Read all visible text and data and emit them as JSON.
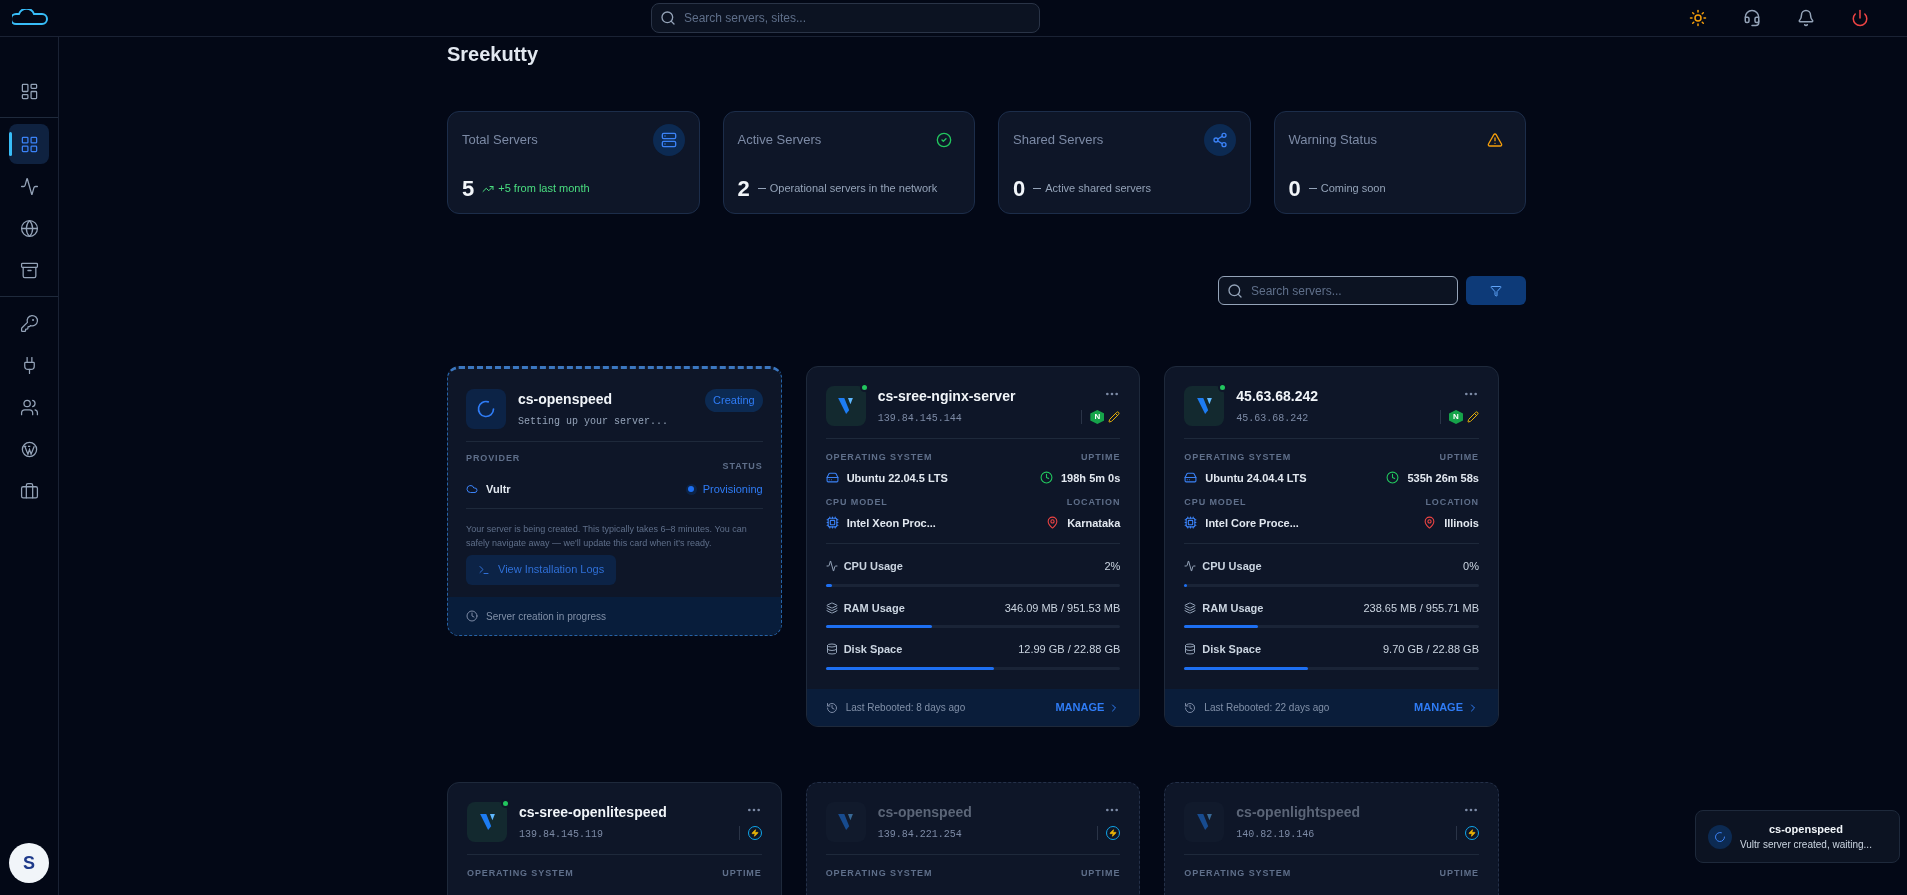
{
  "topbar": {
    "search": {
      "placeholder": "Search servers, sites..."
    }
  },
  "sidebar": {
    "groups": [
      [
        {
          "selected": false
        }
      ],
      [
        {
          "selected": true
        },
        {
          "selected": false
        },
        {
          "selected": false
        },
        {
          "selected": false
        }
      ],
      [
        {
          "selected": false
        },
        {
          "selected": false
        },
        {
          "selected": false
        },
        {
          "selected": false
        },
        {
          "selected": false
        }
      ]
    ],
    "avatar": "S"
  },
  "page": {
    "title": "Sreekutty"
  },
  "stats": [
    {
      "label": "Total Servers",
      "value": "5",
      "note": "+5 from last month",
      "kind": "trend"
    },
    {
      "label": "Active Servers",
      "value": "2",
      "note": "Operational servers in the network",
      "kind": "plain"
    },
    {
      "label": "Shared Servers",
      "value": "0",
      "note": "Active shared servers",
      "kind": "plain"
    },
    {
      "label": "Warning Status",
      "value": "0",
      "note": "Coming soon",
      "kind": "plain"
    }
  ],
  "server_search": {
    "placeholder": "Search servers..."
  },
  "servers": [
    {
      "kind": "creating",
      "name": "cs-openspeed",
      "subtitle": "Setting up your server...",
      "badge": "Creating",
      "provider_label": "PROVIDER",
      "provider": "Vultr",
      "status_label": "STATUS",
      "status": "Provisioning",
      "message": "Your server is being created. This typically takes 6–8 minutes. You can safely navigate away — we'll update this card when it's ready.",
      "logs_button": "View Installation Logs",
      "footer": "Server creation in progress"
    },
    {
      "kind": "active",
      "online": true,
      "name": "cs-sree-nginx-server",
      "ip": "139.84.145.144",
      "stack": [
        {
          "kind": "nginx",
          "label": "N"
        },
        {
          "kind": "pencil"
        }
      ],
      "os_label": "OPERATING SYSTEM",
      "os": "Ubuntu 22.04.5 LTS",
      "uptime_label": "UPTIME",
      "uptime": "198h 5m 0s",
      "cpu_label": "CPU MODEL",
      "cpu": "Intel Xeon Proc...",
      "location_label": "LOCATION",
      "location": "Karnataka",
      "metrics": [
        {
          "kind": "cpu",
          "label": "CPU Usage",
          "reading": "2%",
          "level": 0.02
        },
        {
          "kind": "ram",
          "label": "RAM Usage",
          "reading": "346.09 MB / 951.53 MB",
          "level": 0.36
        },
        {
          "kind": "disk",
          "label": "Disk Space",
          "reading": "12.99 GB / 22.88 GB",
          "level": 0.57
        }
      ],
      "footer": "Last Rebooted: 8 days ago",
      "manage": "MANAGE"
    },
    {
      "kind": "active",
      "online": true,
      "name": "45.63.68.242",
      "ip": "45.63.68.242",
      "stack": [
        {
          "kind": "nginx",
          "label": "N"
        },
        {
          "kind": "pencil"
        }
      ],
      "os_label": "OPERATING SYSTEM",
      "os": "Ubuntu 24.04.4 LTS",
      "uptime_label": "UPTIME",
      "uptime": "535h 26m 58s",
      "cpu_label": "CPU MODEL",
      "cpu": "Intel Core Proce...",
      "location_label": "LOCATION",
      "location": "Illinois",
      "metrics": [
        {
          "kind": "cpu",
          "label": "CPU Usage",
          "reading": "0%",
          "level": 0.0
        },
        {
          "kind": "ram",
          "label": "RAM Usage",
          "reading": "238.65 MB / 955.71 MB",
          "level": 0.25
        },
        {
          "kind": "disk",
          "label": "Disk Space",
          "reading": "9.70 GB / 22.88 GB",
          "level": 0.42
        }
      ],
      "footer": "Last Rebooted: 22 days ago",
      "manage": "MANAGE"
    },
    {
      "kind": "partial",
      "online": true,
      "disabled": false,
      "name": "cs-sree-openlitespeed",
      "ip": "139.84.145.119",
      "stack": [
        {
          "kind": "lightning"
        }
      ],
      "os_label": "OPERATING SYSTEM",
      "uptime_label": "UPTIME"
    },
    {
      "kind": "partial",
      "online": false,
      "disabled": true,
      "name": "cs-openspeed",
      "ip": "139.84.221.254",
      "stack": [
        {
          "kind": "lightning"
        }
      ],
      "os_label": "OPERATING SYSTEM",
      "uptime_label": "UPTIME"
    },
    {
      "kind": "partial",
      "online": false,
      "disabled": true,
      "name": "cs-openlightspeed",
      "ip": "140.82.19.146",
      "stack": [
        {
          "kind": "lightning"
        }
      ],
      "os_label": "OPERATING SYSTEM",
      "uptime_label": "UPTIME"
    }
  ],
  "toast": {
    "title": "cs-openspeed",
    "message": "Vultr server created, waiting..."
  }
}
